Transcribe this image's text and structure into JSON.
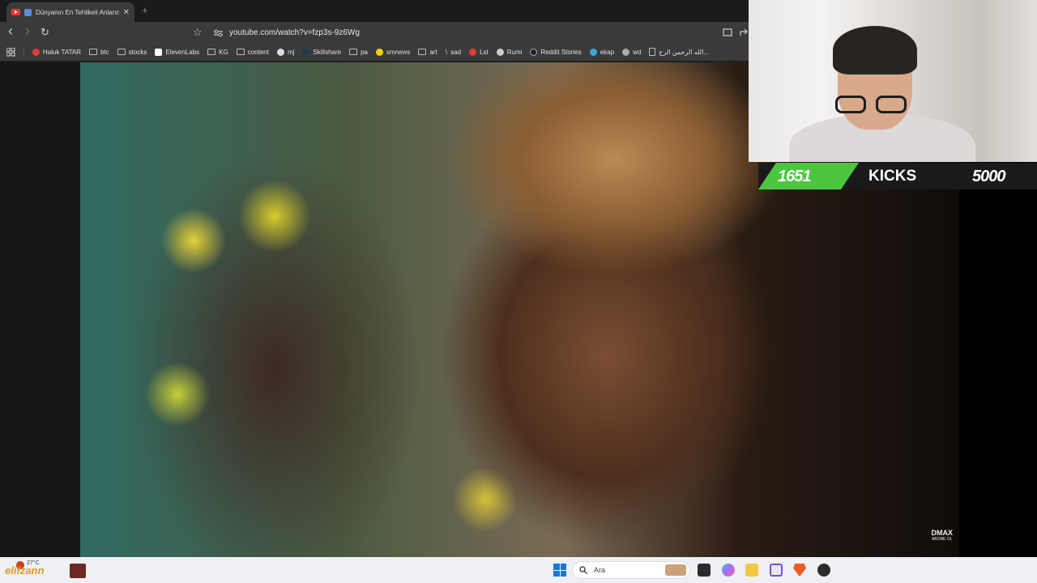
{
  "browser": {
    "tab": {
      "title": "Dünyanın En Tehlikeli Anların",
      "close": "✕"
    },
    "new_tab": "+",
    "nav": {
      "back": "‹",
      "forward": "›",
      "reload": "↻",
      "bookmark": "☆"
    },
    "url": "youtube.com/watch?v=fzp3s-9z6Wg",
    "bookmarks": [
      {
        "label": "Haluk TATAR",
        "icon": "youtube-icon"
      },
      {
        "label": "btc",
        "icon": "folder-icon"
      },
      {
        "label": "stocks",
        "icon": "folder-icon"
      },
      {
        "label": "ElevenLabs",
        "icon": "elevenlabs-icon"
      },
      {
        "label": "KG",
        "icon": "folder-icon"
      },
      {
        "label": "content",
        "icon": "folder-icon"
      },
      {
        "label": "mj",
        "icon": "github-icon"
      },
      {
        "label": "Skillshare",
        "icon": "skillshare-icon"
      },
      {
        "label": "pa",
        "icon": "folder-icon"
      },
      {
        "label": "smnews",
        "icon": "smiley-icon"
      },
      {
        "label": "art",
        "icon": "folder-icon"
      },
      {
        "label": "sad",
        "icon": "slash-icon"
      },
      {
        "label": "Lst",
        "icon": "s-icon"
      },
      {
        "label": "Rumi",
        "icon": "globe-icon"
      },
      {
        "label": "Reddit Stories",
        "icon": "d-icon"
      },
      {
        "label": "ekap",
        "icon": "bird-icon"
      },
      {
        "label": "wd",
        "icon": "globe-icon"
      },
      {
        "label": "الله الرحمن الرح...",
        "icon": "page-icon"
      }
    ]
  },
  "video": {
    "watermark": "DMAX",
    "watermark_sub": "ABONE OL"
  },
  "overlay": {
    "left_count": "1651",
    "label": "KICKS",
    "right_count": "5000",
    "accent": "#4cc63f"
  },
  "taskbar": {
    "weather_brand": "elifzann",
    "weather_temp": "27°C",
    "search_label": "Ara",
    "icons": [
      "windows-start-icon",
      "search-icon",
      "taskview-icon",
      "copilot-icon",
      "file-explorer-icon",
      "snipping-tool-icon",
      "brave-icon",
      "obs-icon"
    ]
  }
}
